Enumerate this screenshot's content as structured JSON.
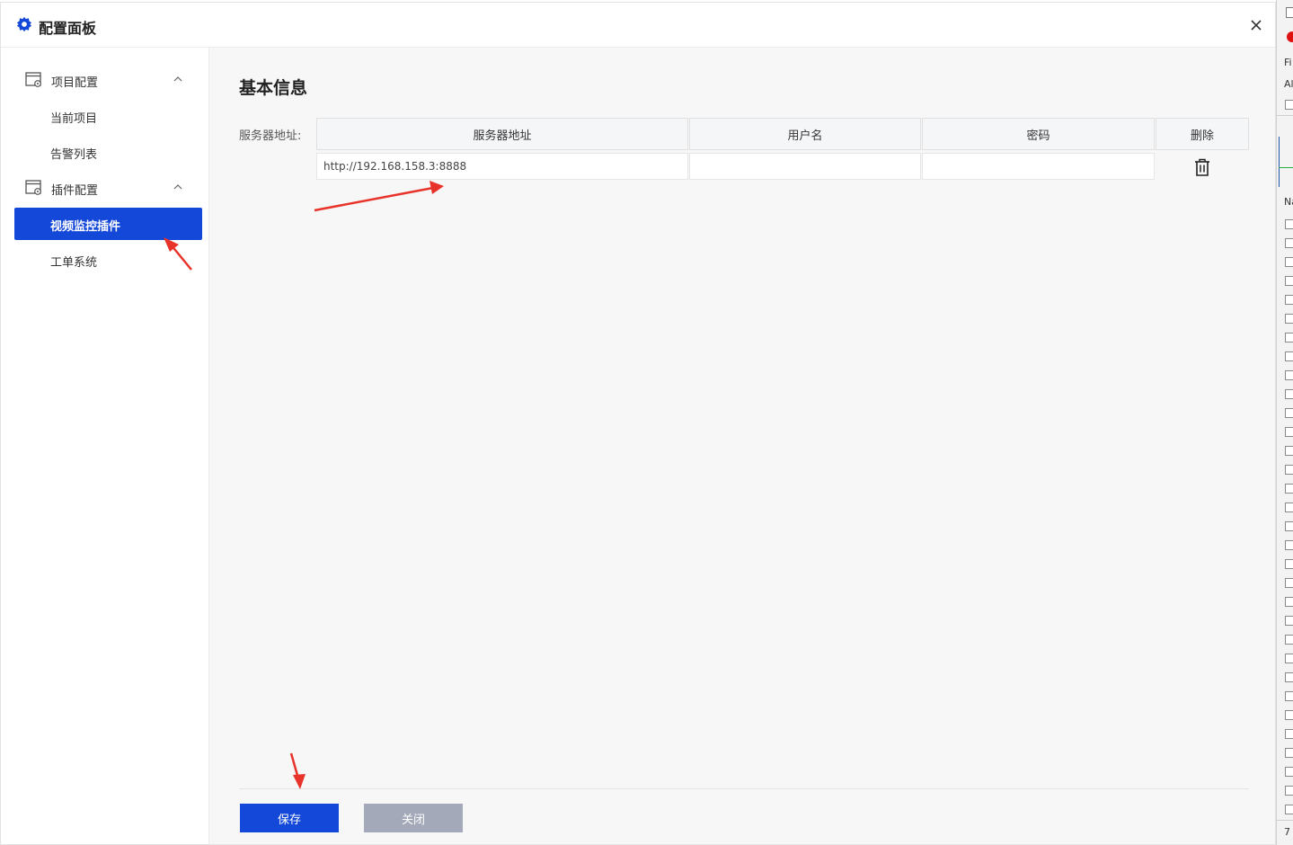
{
  "window": {
    "title": "配置面板",
    "close_icon": "close-icon",
    "title_icon": "gear-icon"
  },
  "sidebar": {
    "groups": [
      {
        "label": "项目配置",
        "expanded": true,
        "items": [
          "当前项目",
          "告警列表"
        ]
      },
      {
        "label": "插件配置",
        "expanded": true,
        "items": [
          "视频监控插件",
          "工单系统"
        ]
      }
    ],
    "active_item": "视频监控插件"
  },
  "main": {
    "section_title": "基本信息",
    "field_label": "服务器地址:",
    "table": {
      "headers": [
        "服务器地址",
        "用户名",
        "密码",
        "删除"
      ],
      "rows": [
        {
          "server": "http://192.168.158.3:8888",
          "username": "",
          "password": ""
        }
      ]
    },
    "buttons": {
      "save": "保存",
      "close": "关闭"
    }
  },
  "side_strip": {
    "labels": [
      "Fi",
      "Al",
      "Na",
      "7"
    ]
  },
  "colors": {
    "accent": "#1448d8",
    "disabled_button": "#a3a9b8",
    "annotation_arrow": "#e8332a"
  }
}
